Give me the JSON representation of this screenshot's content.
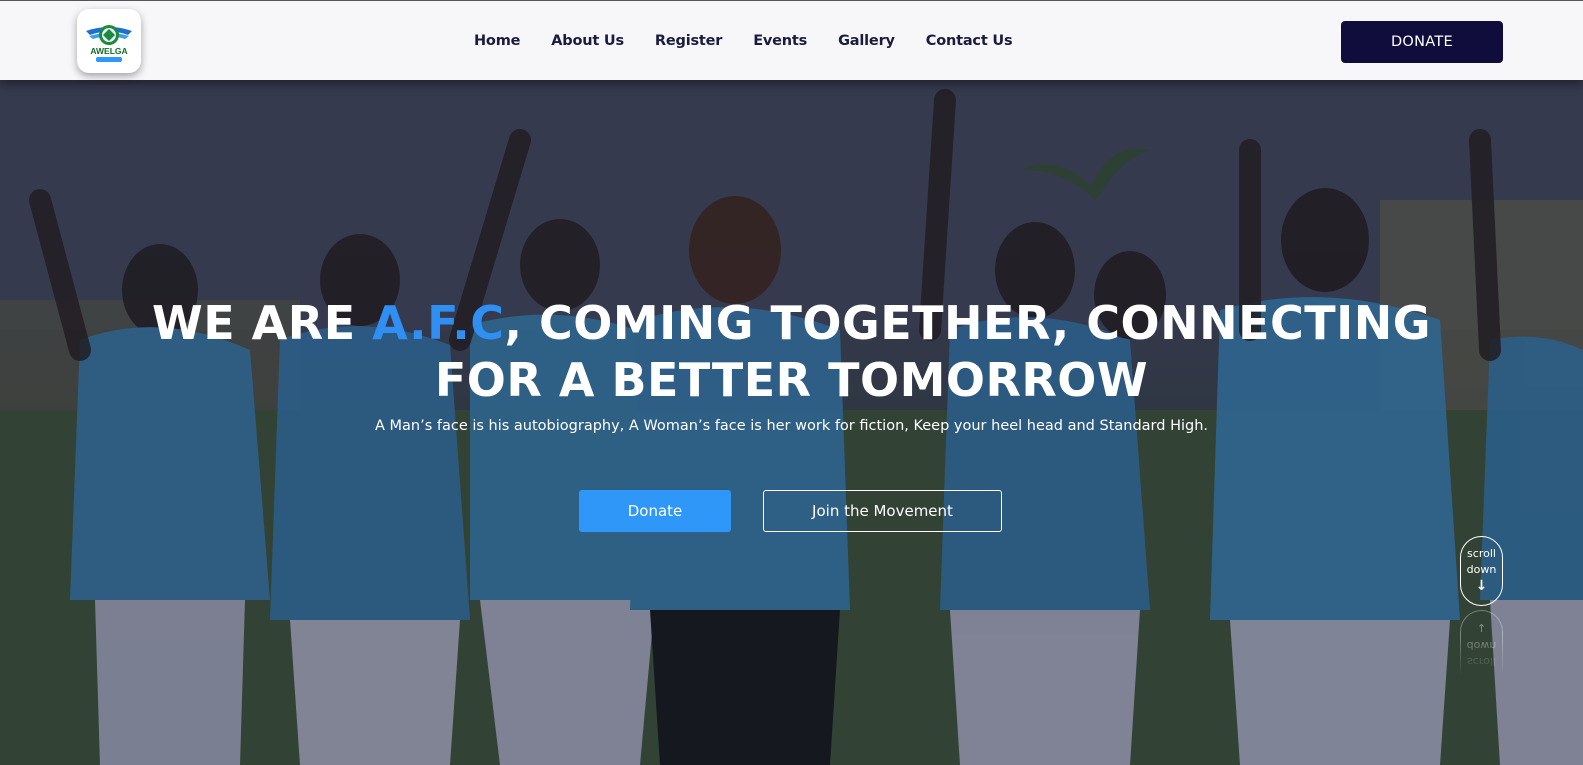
{
  "header": {
    "logo_text": "AWELGA",
    "nav": [
      {
        "label": "Home"
      },
      {
        "label": "About Us"
      },
      {
        "label": "Register"
      },
      {
        "label": "Events"
      },
      {
        "label": "Gallery"
      },
      {
        "label": "Contact Us"
      }
    ],
    "donate_label": "DONATE"
  },
  "hero": {
    "headline_pre": "WE ARE ",
    "headline_accent": "A.F.C",
    "headline_post": ", COMING TOGETHER, CONNECTING",
    "headline_line2": "FOR A BETTER TOMORROW",
    "subline": "A Man’s face is his autobiography, A Woman’s face is her work for fiction, Keep your heel head and Standard High.",
    "donate_button": "Donate",
    "join_button": "Join the Movement",
    "scroll_line1": "scroll",
    "scroll_line2": "down",
    "scroll_arrow": "↓",
    "scroll_up_arrow": "↑",
    "scroll_ghost_line1": "down",
    "scroll_ghost_line2": "scroll"
  },
  "colors": {
    "accent": "#2f8ff2",
    "donate_top_bg": "#100c3b",
    "donate_button_bg": "#2f97f7",
    "nav_text": "#1b1c3d"
  },
  "icons": {
    "logo": "awelga-logo-emblem",
    "scroll_down": "arrow-down-icon",
    "scroll_up": "arrow-up-icon"
  }
}
